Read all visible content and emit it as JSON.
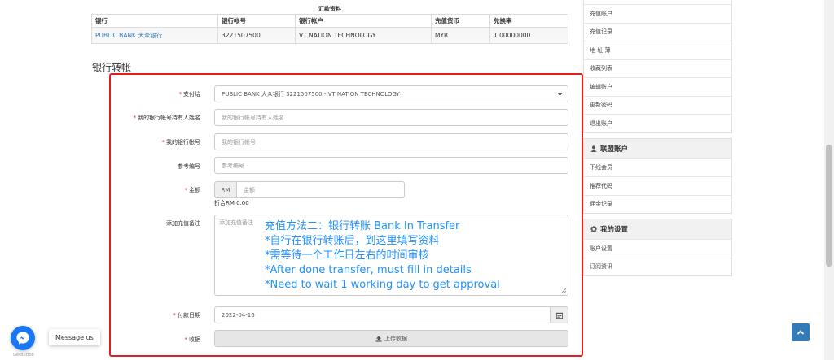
{
  "remit": {
    "caption": "汇款资料",
    "headers": [
      "银行",
      "银行帐号",
      "银行帐户",
      "充值货币",
      "兑换率"
    ],
    "row": [
      "PUBLIC BANK 大众银行",
      "3221507500",
      "VT NATION TECHNOLOGY",
      "MYR",
      "1.00000000"
    ]
  },
  "section_title": "银行转帐",
  "form": {
    "pay_to_label": "支付给",
    "pay_to_value": "PUBLIC BANK 大众银行 3221507500 - VT NATION TECHNOLOGY",
    "holder_label": "我的银行帐号持有人姓名",
    "holder_placeholder": "我的银行帐号持有人姓名",
    "account_label": "我的银行帐号",
    "account_placeholder": "我的银行帐号",
    "ref_label": "参考编号",
    "ref_placeholder": "参考编号",
    "amount_label": "金额",
    "amount_addon": "RM",
    "amount_placeholder": "金额",
    "convert_text": "折合RM 0.00",
    "remark_label": "添加充值备注",
    "remark_placeholder": "添加充值备注",
    "date_label": "付款日期",
    "date_value": "2022-04-16",
    "receipt_label": "收据",
    "upload_label": "上传收据"
  },
  "note_lines": [
    "充值方法二：银行转账 Bank In Transfer",
    "*自行在银行转账后，到这里填写资料",
    "*需等待一个工作日左右的时间审核",
    "*After done transfer, must fill in details",
    "*Need to wait 1 working day to get approval"
  ],
  "sidebar": {
    "account_items": [
      "充值账户",
      "充值记录",
      "地 址 薄",
      "收藏列表",
      "编辑账户",
      "更新密码",
      "退出账户"
    ],
    "alliance_title": "联盟账户",
    "alliance_items": [
      "下线会员",
      "推荐代码",
      "佣金记录"
    ],
    "settings_title": "我的设置",
    "settings_items": [
      "账户设置",
      "订阅资讯"
    ]
  },
  "widgets": {
    "message_us": "Message us",
    "getbutton": "GetButton"
  },
  "colors": {
    "accent": "#337ab7",
    "highlight": "#e02020",
    "note": "#1e90ff",
    "messenger": "#1877f2"
  }
}
